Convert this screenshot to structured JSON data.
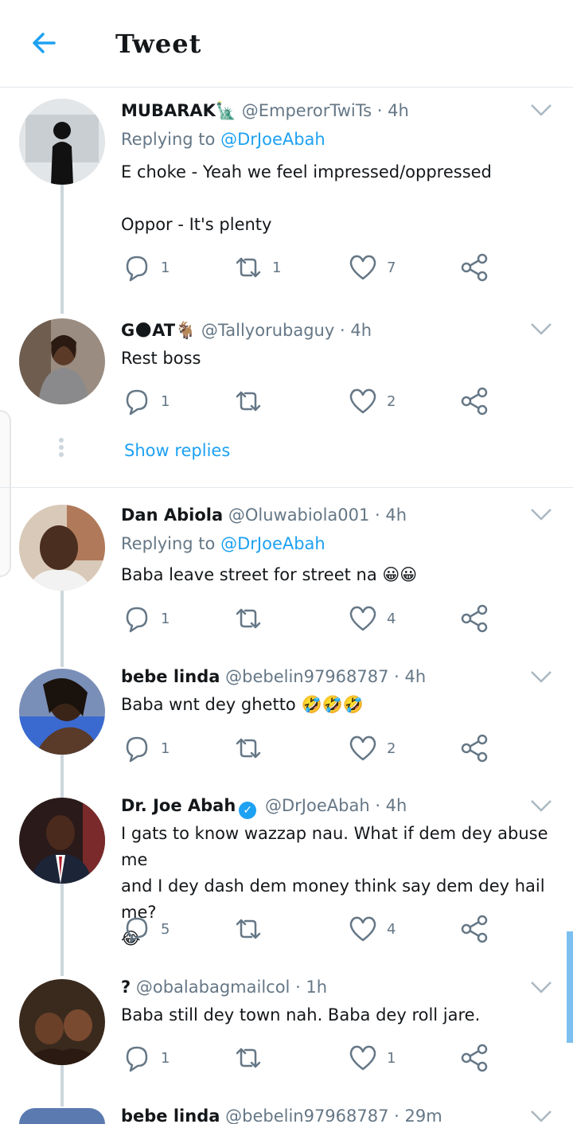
{
  "header": {
    "title": "Tweet"
  },
  "tweets": [
    {
      "name": "MUBARAK🗽",
      "handle": "@EmperorTwiTs",
      "time": "· 4h",
      "reply_label": "Replying to",
      "reply_to": "@DrJoeAbah",
      "text_line1": "E choke - Yeah we feel impressed/oppressed",
      "text_line2": "Oppor - It's plenty",
      "replies": "1",
      "retweets": "1",
      "likes": "7"
    },
    {
      "name": "G🌑AT🐐",
      "handle": "@Tallyorubaguy",
      "time": "· 4h",
      "text": "Rest boss",
      "replies": "1",
      "retweets": "",
      "likes": "2"
    },
    {
      "name": "Dan Abiola",
      "handle": "@Oluwabiola001",
      "time": "· 4h",
      "reply_label": "Replying to",
      "reply_to": "@DrJoeAbah",
      "text": "Baba leave street for street na 😀😀",
      "replies": "1",
      "retweets": "",
      "likes": "4"
    },
    {
      "name": "bebe linda",
      "handle": "@bebelin97968787",
      "time": "· 4h",
      "text": "Baba wnt dey ghetto 🤣🤣🤣",
      "replies": "1",
      "retweets": "",
      "likes": "2"
    },
    {
      "name": "Dr. Joe Abah",
      "handle": "@DrJoeAbah",
      "time": "· 4h",
      "text_line1": "I gats to know wazzap nau. What if dem dey abuse me",
      "text_line2": "and I dey dash dem money think say dem dey hail me?",
      "text_line3": "😂",
      "replies": "5",
      "retweets": "",
      "likes": "4"
    },
    {
      "name": "?",
      "handle": "@obalabagmailcol",
      "time": "· 1h",
      "text": "Baba still dey town nah. Baba dey roll jare.",
      "replies": "1",
      "retweets": "",
      "likes": "1"
    },
    {
      "name": "bebe linda",
      "handle": "@bebelin97968787",
      "time": "· 29m"
    }
  ],
  "show_replies": "Show replies",
  "colors": {
    "accent": "#1da1f2",
    "muted": "#657786",
    "divider": "#e1e8ed",
    "thread": "#ccd6dd"
  }
}
